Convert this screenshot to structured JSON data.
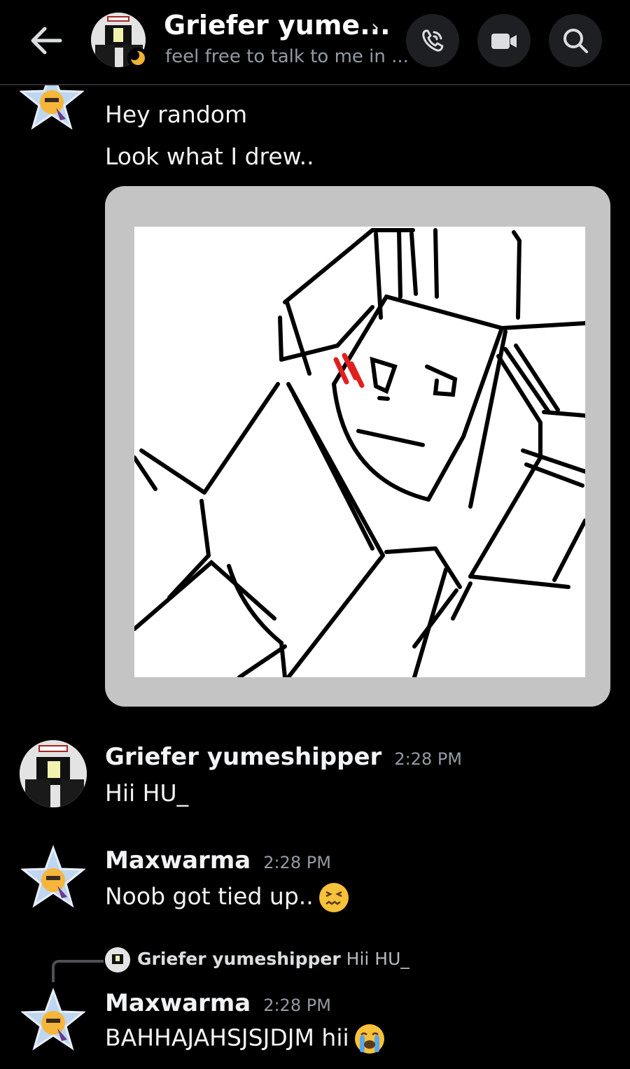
{
  "header": {
    "title": "Griefer yume...",
    "subtitle": "feel free to talk  to me in ..."
  },
  "messages": [
    {
      "author": "",
      "timestamp": "",
      "lines": [
        "Hey random",
        "Look what I drew.."
      ]
    },
    {
      "author": "Griefer yumeshipper",
      "timestamp": "2:28 PM",
      "lines": [
        "Hii HU_"
      ]
    },
    {
      "author": "Maxwarma",
      "timestamp": "2:28 PM",
      "lines": [
        "Noob got tied up.."
      ]
    },
    {
      "reply_to_author": "Griefer yumeshipper",
      "reply_to_text": "Hii HU_",
      "author": "Maxwarma",
      "timestamp": "2:28 PM",
      "lines": [
        "BAHHAJAHSJSJDJM hii"
      ]
    }
  ],
  "icons": {
    "back": "arrow-left-icon",
    "call": "phone-icon",
    "video": "video-camera-icon",
    "search": "search-icon",
    "emoji1": "confounded-face-emoji",
    "emoji2": "loudly-crying-face-emoji"
  },
  "colors": {
    "background": "#000000",
    "text": "#f2f3f5",
    "muted": "#949ba4",
    "button_bg": "#1e1f22",
    "image_frame": "#c4c4c4"
  }
}
